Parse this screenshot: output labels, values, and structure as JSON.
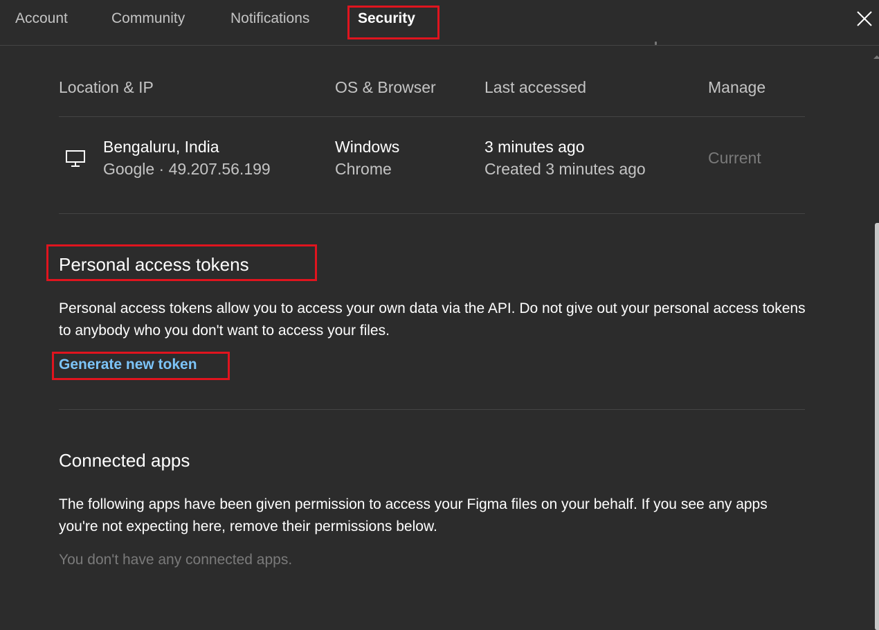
{
  "tabs": [
    {
      "label": "Account",
      "active": false
    },
    {
      "label": "Community",
      "active": false
    },
    {
      "label": "Notifications",
      "active": false
    },
    {
      "label": "Security",
      "active": true
    }
  ],
  "close_icon": "close-icon",
  "sessions": {
    "headers": {
      "location": "Location & IP",
      "os_browser": "OS & Browser",
      "last_accessed": "Last accessed",
      "manage": "Manage"
    },
    "rows": [
      {
        "device_icon": "monitor-icon",
        "location": "Bengaluru, India",
        "ip": "Google · 49.207.56.199",
        "os": "Windows",
        "browser": "Chrome",
        "last_accessed": "3 minutes ago",
        "created": "Created 3 minutes ago",
        "manage": "Current"
      }
    ]
  },
  "personal_access_tokens": {
    "title": "Personal access tokens",
    "description": "Personal access tokens allow you to access your own data via the API. Do not give out your personal access tokens to anybody who you don't want to access your files.",
    "link_label": "Generate new token"
  },
  "connected_apps": {
    "title": "Connected apps",
    "description": "The following apps have been given permission to access your Figma files on your behalf. If you see any apps you're not expecting here, remove their permissions below.",
    "empty_text": "You don't have any connected apps."
  },
  "colors": {
    "background": "#2c2c2c",
    "link": "#7cc4f8",
    "highlight": "#e0141e",
    "muted": "#7a7a7a",
    "secondary": "#c4c4c4"
  }
}
